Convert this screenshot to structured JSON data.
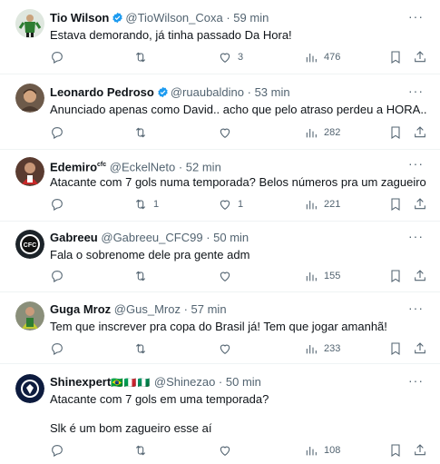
{
  "tweets": [
    {
      "name": "Tio Wilson",
      "verified": true,
      "handle": "@TioWilson_Coxa",
      "time": "59 min",
      "text": [
        "Estava demorando, já tinha passado Da Hora!"
      ],
      "replies": "",
      "retweets": "",
      "likes": "3",
      "views": "476",
      "avatar_color": "#2e7d32"
    },
    {
      "name": "Leonardo Pedroso",
      "verified": true,
      "handle": "@ruaubaldino",
      "time": "53 min",
      "text": [
        "Anunciado apenas como David.. acho que pelo atraso perdeu a HORA.."
      ],
      "replies": "",
      "retweets": "",
      "likes": "",
      "views": "282",
      "avatar_color": "#8d6e63"
    },
    {
      "name": "Edemiro",
      "name_suffix": "cfc",
      "verified": false,
      "handle": "@EckelNeto",
      "time": "52 min",
      "text": [
        "Atacante com 7 gols numa temporada? Belos números pra um zagueiro"
      ],
      "replies": "",
      "retweets": "1",
      "likes": "1",
      "views": "221",
      "avatar_color": "#b71c1c"
    },
    {
      "name": "Gabreeu",
      "verified": false,
      "handle": "@Gabreeu_CFC99",
      "time": "50 min",
      "text": [
        "Fala o sobrenome dele pra gente adm"
      ],
      "replies": "",
      "retweets": "",
      "likes": "",
      "views": "155",
      "avatar_color": "#263238"
    },
    {
      "name": "Guga Mroz",
      "verified": false,
      "handle": "@Gus_Mroz",
      "time": "57 min",
      "text": [
        "Tem que inscrever pra copa do Brasil já! Tem que jogar amanhã!"
      ],
      "replies": "",
      "retweets": "",
      "likes": "",
      "views": "233",
      "avatar_color": "#9e9d24"
    },
    {
      "name": "Shinexpert",
      "flags": "🇧🇷🇮🇹🇳🇬",
      "verified": false,
      "handle": "@Shinezao",
      "time": "50 min",
      "text": [
        "Atacante com 7 gols em uma temporada?",
        "",
        "Slk é um bom zagueiro esse aí"
      ],
      "replies": "",
      "retweets": "",
      "likes": "",
      "views": "108",
      "avatar_color": "#0d1b3e"
    }
  ],
  "colors": {
    "text": "#0f1419",
    "muted": "#536471",
    "verified": "#1d9bf0",
    "divider": "#eff3f4"
  }
}
